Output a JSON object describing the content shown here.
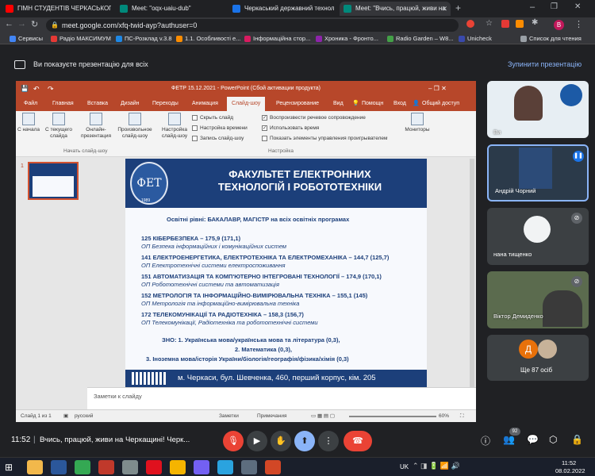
{
  "browser": {
    "tabs": [
      {
        "title": "ГІМН СТУДЕНТІВ ЧЕРКАСЬКОГ",
        "favicon_color": "#ff0000"
      },
      {
        "title": "Meet: \"oqx-uaiu-dub\"",
        "favicon_color": "#00897b"
      },
      {
        "title": "Черкаський державний технол",
        "favicon_color": "#1a73e8"
      },
      {
        "title": "Meet: \"Вчись, працюй, живи на",
        "favicon_color": "#00897b"
      }
    ],
    "profile_initial": "В",
    "url": "meet.google.com/xfq-twid-ayp?authuser=0",
    "bookmarks": [
      {
        "label": "Сервисы",
        "color": "#4285f4"
      },
      {
        "label": "Радіо МАКСИМУМ",
        "color": "#e53935"
      },
      {
        "label": "ПС-Розклад v.3.8",
        "color": "#1e88e5"
      },
      {
        "label": "1.1. Особливості е...",
        "color": "#fb8c00"
      },
      {
        "label": "Інформаційна стор...",
        "color": "#d81b60"
      },
      {
        "label": "Хроника - Фронто...",
        "color": "#8e24aa"
      },
      {
        "label": "Radio Garden – W8...",
        "color": "#43a047"
      },
      {
        "label": "Unicheck",
        "color": "#3949ab"
      },
      {
        "label": "Список для чтения",
        "color": "#9aa0a6"
      }
    ]
  },
  "meet": {
    "presenting_text": "Ви показуєте презентацію для всіх",
    "stop_label": "Зупинити презентацію",
    "time": "11:52",
    "meeting_title": "Вчись, працюй, живи на Черкащині! Черк...",
    "participants_badge": "92",
    "participants": [
      {
        "name": "Ви"
      },
      {
        "name": "Андрій Чорний"
      },
      {
        "name": "нана тищенко"
      },
      {
        "name": "Віктор Демиденко"
      }
    ],
    "others_label": "Ще 87 осіб",
    "others_initial": "Д"
  },
  "ppt": {
    "title": "ФЕТР 15.12.2021 - PowerPoint (Сбой активации продукта)",
    "tabs": [
      "Файл",
      "Главная",
      "Вставка",
      "Дизайн",
      "Переходы",
      "Анимация",
      "Слайд-шоу",
      "Рецензирование",
      "Вид"
    ],
    "search": "Помощн",
    "login": "Вход",
    "share": "Общий доступ",
    "ribbon": {
      "from_start": "С начала",
      "from_current": "С текущего слайда",
      "online": "Онлайн-презентация",
      "custom": "Произвольное слайд-шоу",
      "setup": "Настройка слайд-шоу",
      "hide": "Скрыть слайд",
      "rehearse": "Настройка времени",
      "record": "Запись слайд-шоу",
      "play_narr": "Воспроизвести речевое сопровождение",
      "use_timings": "Использовать время",
      "show_controls": "Показать элементы управления проигрывателем",
      "monitors": "Мониторы",
      "group_start": "Начать слайд-шоу",
      "group_setup": "Настройка"
    },
    "thumb_number": "1",
    "notes": "Заметки к слайду",
    "status_slide": "Слайд 1 из 1",
    "status_lang": "русский",
    "status_notes": "Заметки",
    "status_comments": "Примечания",
    "zoom": "60%"
  },
  "slide": {
    "logo_text": "ФЕТ",
    "logo_year": "1989",
    "title": "ФАКУЛЬТЕТ ЕЛЕКТРОННИХ\nТЕХНОЛОГІЙ І РОБОТОТЕХНІКИ",
    "levels": "Освітні рівні: БАКАЛАВР, МАГІСТР на всіх освітніх програмах",
    "programs": [
      {
        "line": "125 КІБЕРБЕЗПЕКА – 175,9 (171,1)",
        "op": "ОП Безпека інформаційних і комунікаційних систем"
      },
      {
        "line": "141 ЕЛЕКТРОЕНЕРГЕТИКА, ЕЛЕКТРОТЕХНІКА ТА ЕЛЕКТРОМЕХАНІКА – 144,7 (125,7)",
        "op": "ОП Електротехнічні системи електроспоживання"
      },
      {
        "line": "151 АВТОМАТИЗАЦІЯ ТА КОМП'ЮТЕРНО ІНТЕГРОВАНІ ТЕХНОЛОГІЇ – 174,9 (170,1)",
        "op": "ОП Робототехнічні системи та автоматизація"
      },
      {
        "line": "152 МЕТРОЛОГІЯ ТА ІНФОРМАЦІЙНО-ВИМІРЮВАЛЬНА ТЕХНІКА – 155,1 (145)",
        "op": "ОП Метрологія та інформаційно-вимірювальна техніка"
      },
      {
        "line": "172 ТЕЛЕКОМУНІКАЦІЇ ТА РАДІОТЕХНІКА – 158,3 (156,7)",
        "op": "ОП Телекомунікації, Радіотехніка та робототехнічні системи"
      }
    ],
    "zno": [
      "ЗНО:  1. Українська мова/українська мова та література (0,3),",
      "2. Математика (0,3),",
      "3. Іноземна мова/історія України/біологія/географія/фізика/хімія (0,3)"
    ],
    "footer": "м. Черкаси, бул. Шевченка, 460, перший корпус, кім. 205"
  },
  "taskbar": {
    "lang": "UK",
    "time": "11:52",
    "date": "08.02.2022",
    "apps": [
      {
        "name": "file-explorer-icon",
        "color": "#f2b84b"
      },
      {
        "name": "word-icon",
        "color": "#2b579a"
      },
      {
        "name": "chrome-icon",
        "color": "#34a853"
      },
      {
        "name": "app-icon",
        "color": "#c0392b"
      },
      {
        "name": "app-icon",
        "color": "#7f8c8d"
      },
      {
        "name": "opera-icon",
        "color": "#e0111e"
      },
      {
        "name": "app-icon",
        "color": "#f5b400"
      },
      {
        "name": "viber-icon",
        "color": "#7360f2"
      },
      {
        "name": "telegram-icon",
        "color": "#2aa3df"
      },
      {
        "name": "app-icon",
        "color": "#5d6d7e"
      },
      {
        "name": "powerpoint-icon",
        "color": "#d24726"
      }
    ]
  }
}
